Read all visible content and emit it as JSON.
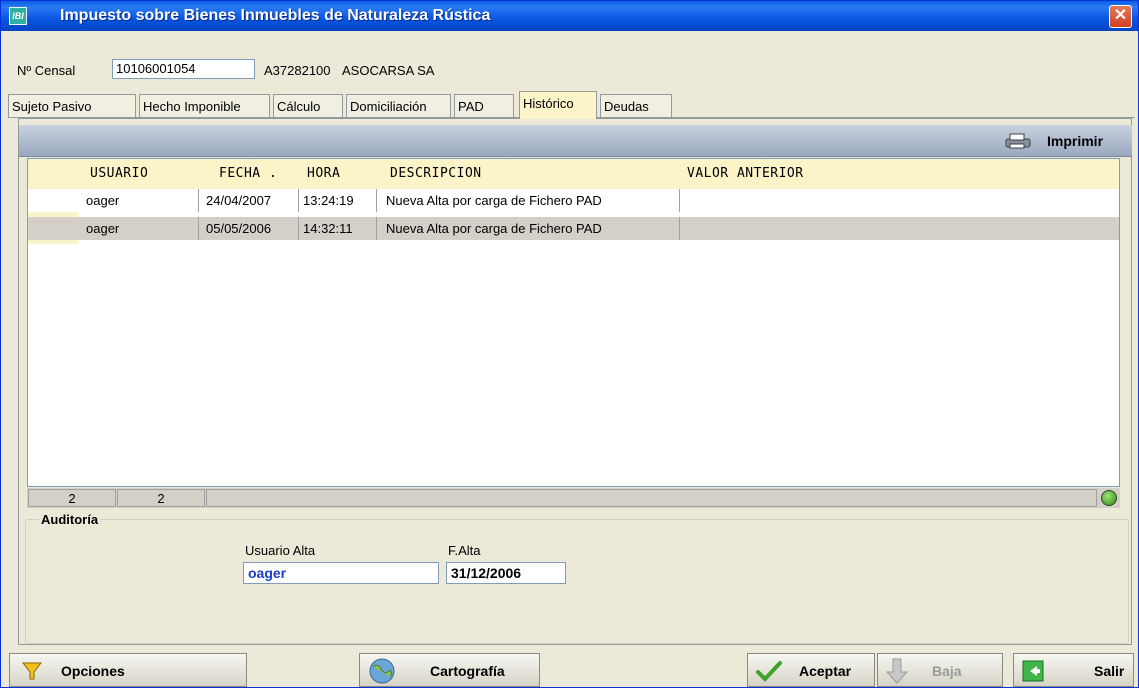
{
  "window": {
    "title": "Impuesto sobre Bienes Inmuebles de Naturaleza Rústica",
    "icon_text": "IBI"
  },
  "header": {
    "censal_label": "Nº Censal",
    "censal_value": "10106001054",
    "nif": "A37282100",
    "name": "ASOCARSA SA"
  },
  "tabs": [
    {
      "label": "Sujeto Pasivo",
      "active": false
    },
    {
      "label": "Hecho Imponible",
      "active": false
    },
    {
      "label": "Cálculo",
      "active": false
    },
    {
      "label": "Domiciliación",
      "active": false
    },
    {
      "label": "PAD",
      "active": false
    },
    {
      "label": "Histórico",
      "active": true
    },
    {
      "label": "Deudas",
      "active": false
    }
  ],
  "toolbar": {
    "print_label": "Imprimir"
  },
  "grid": {
    "columns": [
      "USUARIO",
      "FECHA .",
      "HORA",
      "DESCRIPCION",
      "VALOR ANTERIOR"
    ],
    "rows": [
      {
        "usuario": "oager",
        "fecha": "24/04/2007",
        "hora": "13:24:19",
        "descripcion": "Nueva Alta por carga de Fichero PAD",
        "valor_anterior": ""
      },
      {
        "usuario": "oager",
        "fecha": "05/05/2006",
        "hora": "14:32:11",
        "descripcion": "Nueva Alta por carga de Fichero PAD",
        "valor_anterior": ""
      }
    ]
  },
  "status": {
    "count1": "2",
    "count2": "2"
  },
  "auditoria": {
    "legend": "Auditoría",
    "usuario_alta_label": "Usuario Alta",
    "usuario_alta_value": "oager",
    "f_alta_label": "F.Alta",
    "f_alta_value": "31/12/2006"
  },
  "buttons": {
    "opciones": "Opciones",
    "cartografia": "Cartografía",
    "aceptar": "Aceptar",
    "baja": "Baja",
    "salir": "Salir"
  },
  "colors": {
    "grid_header": "#fbf4c8",
    "title_blue": "#0a5fe6",
    "field_value_blue": "#1a3cc8"
  }
}
